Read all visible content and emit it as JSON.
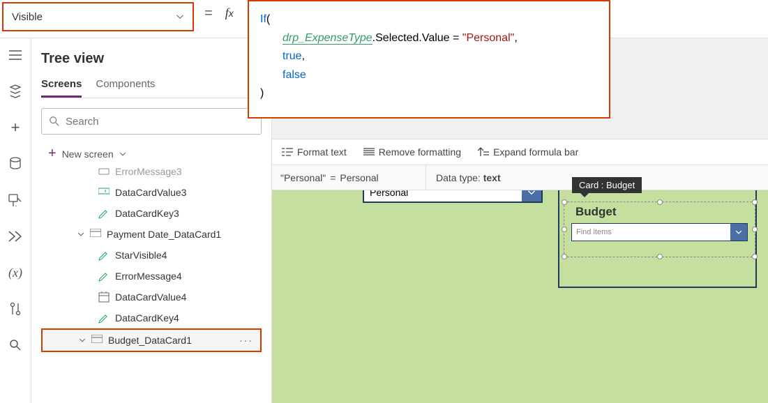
{
  "property_dropdown": {
    "value": "Visible"
  },
  "formula": {
    "fn": "If",
    "ref": "drp_ExpenseType",
    "chain": ".Selected.Value = ",
    "string": "\"Personal\"",
    "true": "true",
    "false": "false"
  },
  "formula_toolbar": {
    "format": "Format text",
    "remove": "Remove formatting",
    "expand": "Expand formula bar"
  },
  "result_bar": {
    "left_lhs": "\"Personal\"",
    "left_eq": "=",
    "left_rhs": "Personal",
    "right_label": "Data type:",
    "right_value": "text"
  },
  "tree": {
    "title": "Tree view",
    "tabs": {
      "screens": "Screens",
      "components": "Components"
    },
    "search_placeholder": "Search",
    "new_screen": "New screen",
    "items": [
      {
        "label": "ErrorMessage3",
        "icon": "text"
      },
      {
        "label": "DataCardValue3",
        "icon": "input"
      },
      {
        "label": "DataCardKey3",
        "icon": "edit"
      },
      {
        "label": "Payment Date_DataCard1",
        "icon": "card",
        "chev": true,
        "level": 1
      },
      {
        "label": "StarVisible4",
        "icon": "edit"
      },
      {
        "label": "ErrorMessage4",
        "icon": "edit"
      },
      {
        "label": "DataCardValue4",
        "icon": "date"
      },
      {
        "label": "DataCardKey4",
        "icon": "edit"
      },
      {
        "label": "Budget_DataCard1",
        "icon": "card",
        "chev": true,
        "level": 1,
        "selected": true
      }
    ]
  },
  "canvas": {
    "personal_value": "Personal",
    "card_label": "Card : Budget",
    "budget_title": "Budget",
    "find_placeholder": "Find items"
  }
}
